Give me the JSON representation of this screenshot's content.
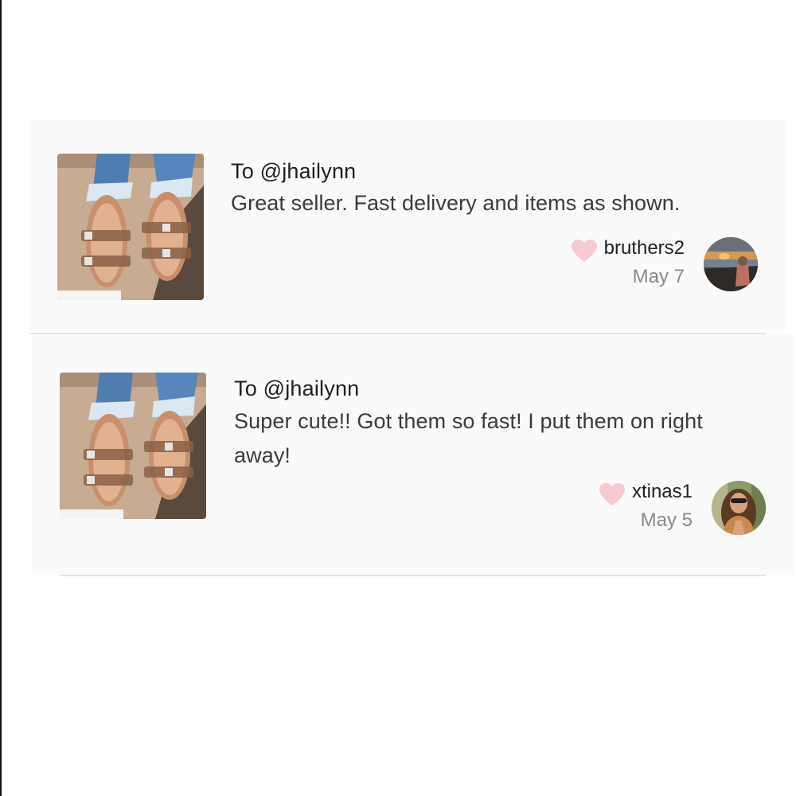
{
  "reviews": [
    {
      "recipient": "To @jhailynn",
      "text": "Great seller. Fast delivery and items as shown.",
      "reviewer": "bruthers2",
      "date": "May 7",
      "thumbnail_icon": "sandals-photo",
      "avatar_icon": "sunset-avatar"
    },
    {
      "recipient": "To @jhailynn",
      "text": "Super cute!! Got them so fast! I put them on right away!",
      "reviewer": "xtinas1",
      "date": "May 5",
      "thumbnail_icon": "sandals-photo",
      "avatar_icon": "portrait-avatar"
    }
  ],
  "colors": {
    "card_background": "#fafafa",
    "divider": "#e6e1e4",
    "heart": "#f7c9d0",
    "date_text": "#8a8a8a"
  }
}
